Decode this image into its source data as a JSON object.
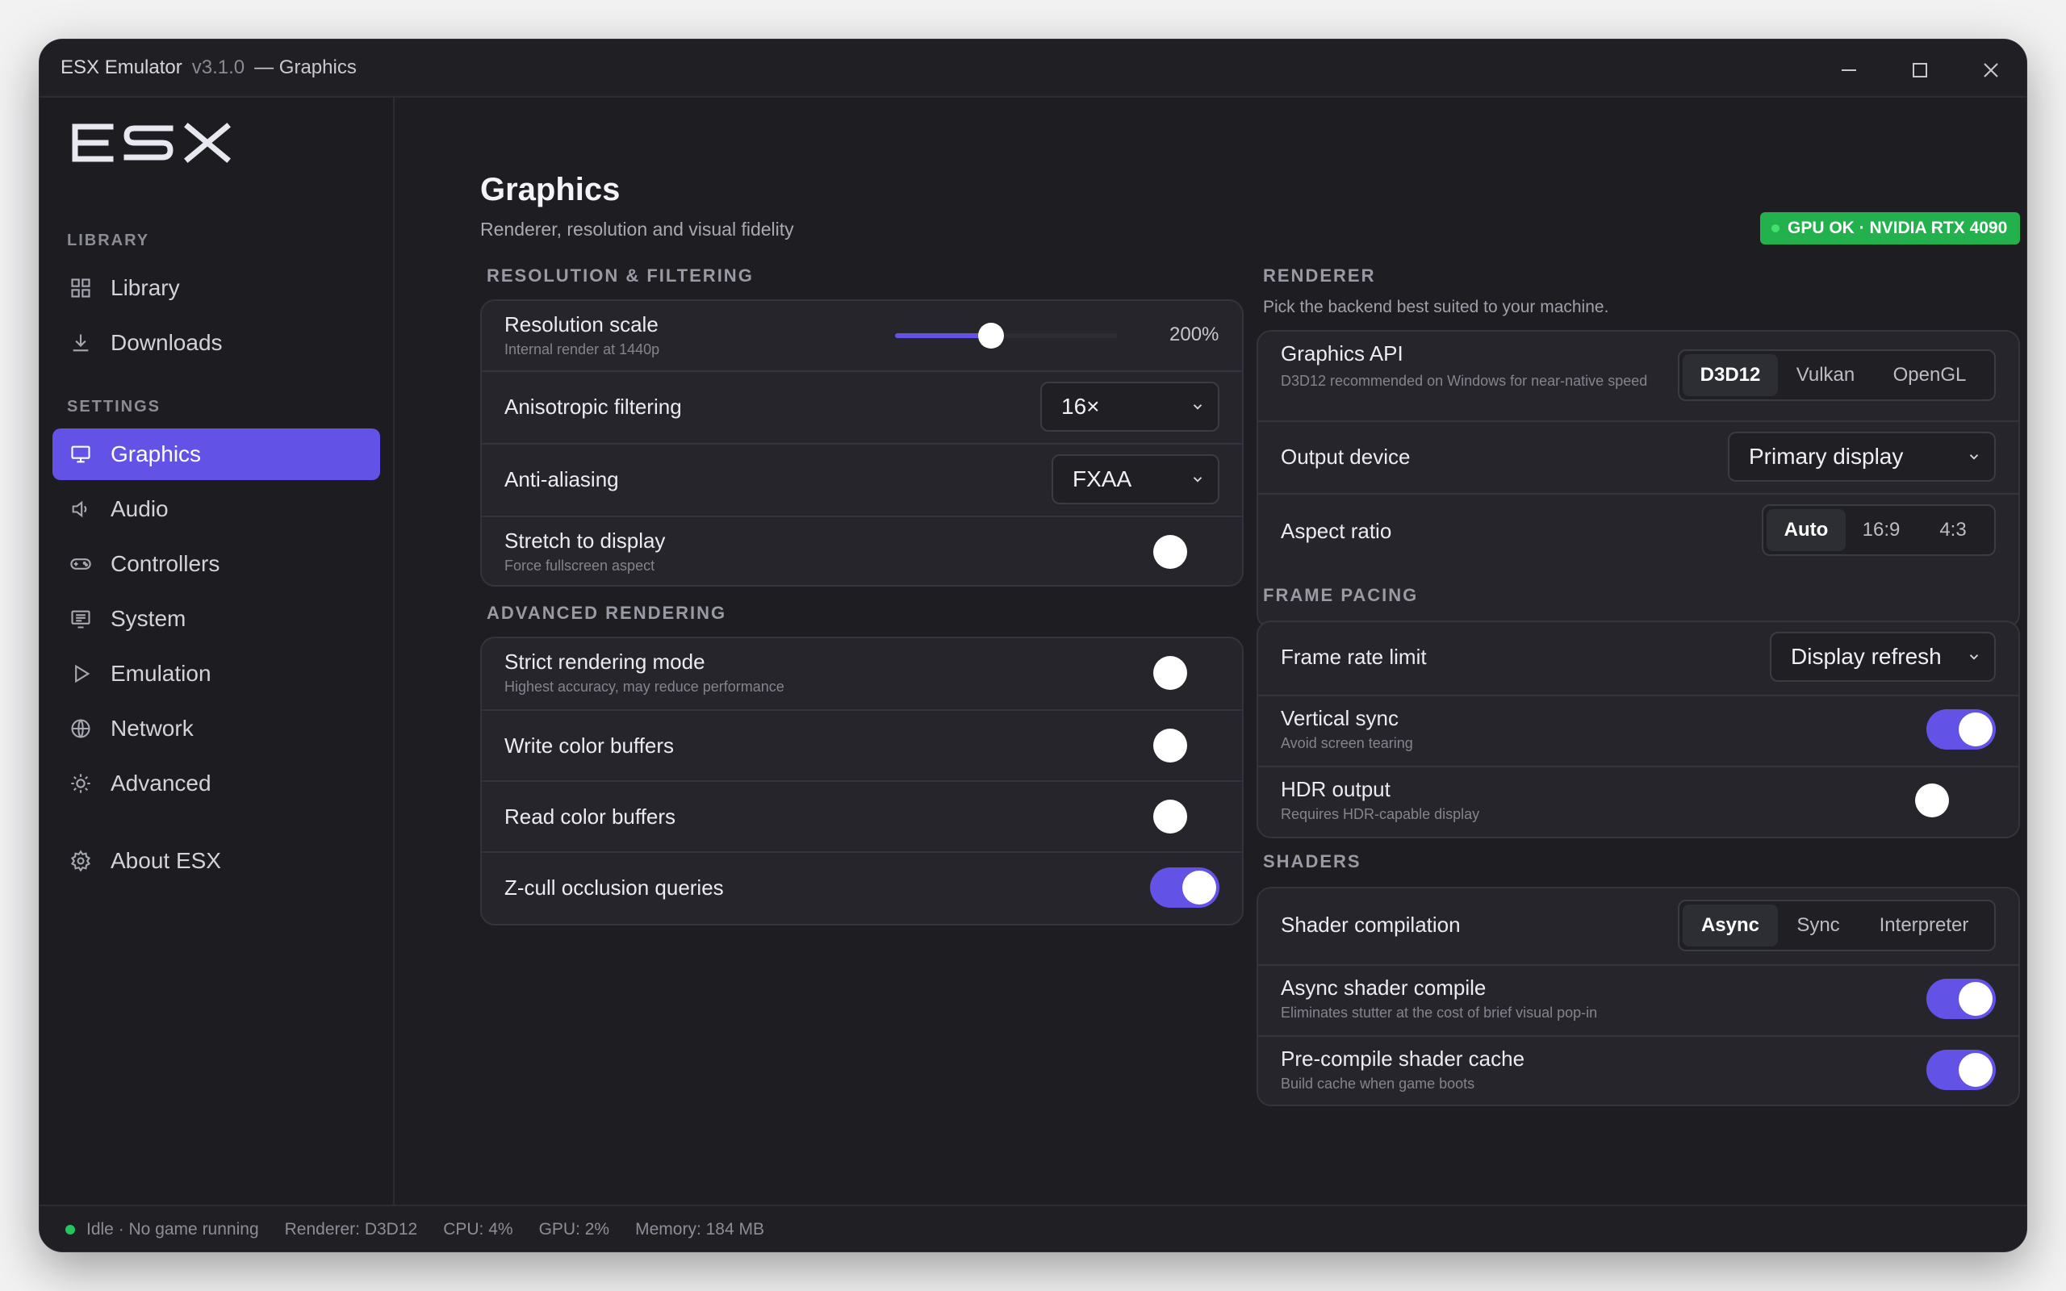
{
  "window": {
    "app_name": "ESX Emulator",
    "version": "v3.1.0",
    "page_suffix": "— Graphics"
  },
  "sidebar": {
    "logo_text": "ESX",
    "library_section": "LIBRARY",
    "settings_section": "SETTINGS",
    "library_items": [
      {
        "label": "Library",
        "icon": "grid-icon"
      },
      {
        "label": "Downloads",
        "icon": "download-icon"
      }
    ],
    "settings_items": [
      {
        "label": "Graphics",
        "icon": "monitor-icon",
        "active": true
      },
      {
        "label": "Audio",
        "icon": "speaker-icon"
      },
      {
        "label": "Controllers",
        "icon": "gamepad-icon"
      },
      {
        "label": "System",
        "icon": "system-icon"
      },
      {
        "label": "Emulation",
        "icon": "play-icon"
      },
      {
        "label": "Network",
        "icon": "globe-icon"
      },
      {
        "label": "Advanced",
        "icon": "sun-icon"
      }
    ],
    "about": {
      "label": "About ESX",
      "icon": "gear-icon"
    }
  },
  "header": {
    "title": "Graphics",
    "subtitle": "Renderer, resolution and visual fidelity",
    "gpu_badge": "GPU OK · NVIDIA RTX 4090"
  },
  "resolution": {
    "section": "RESOLUTION & FILTERING",
    "scale_label": "Resolution scale",
    "scale_hint": "Internal render at 1440p",
    "scale_value": "200%",
    "scale_fraction": 0.43,
    "aniso_label": "Anisotropic filtering",
    "aniso_value": "16×",
    "aa_label": "Anti-aliasing",
    "aa_value": "FXAA",
    "stretch_label": "Stretch to display",
    "stretch_hint": "Force fullscreen aspect",
    "stretch_on": false
  },
  "advanced": {
    "section": "ADVANCED RENDERING",
    "strict_label": "Strict rendering mode",
    "strict_hint": "Highest accuracy, may reduce performance",
    "strict_on": false,
    "write_label": "Write color buffers",
    "write_on": false,
    "read_label": "Read color buffers",
    "read_on": false,
    "zcull_label": "Z-cull occlusion queries",
    "zcull_on": true
  },
  "renderer": {
    "section": "RENDERER",
    "desc": "Pick the backend best suited to your machine.",
    "api_label": "Graphics API",
    "api_hint": "D3D12 recommended on Windows for near-native speed",
    "api_options": [
      "D3D12",
      "Vulkan",
      "OpenGL"
    ],
    "api_selected": "D3D12",
    "output_label": "Output device",
    "output_value": "Primary display",
    "aspect_label": "Aspect ratio",
    "aspect_options": [
      "Auto",
      "16:9",
      "4:3"
    ],
    "aspect_selected": "Auto"
  },
  "frame_pacing": {
    "section": "FRAME PACING",
    "limit_label": "Frame rate limit",
    "limit_value": "Display refresh",
    "vsync_label": "Vertical sync",
    "vsync_hint": "Avoid screen tearing",
    "vsync_on": true,
    "hdr_label": "HDR output",
    "hdr_hint": "Requires HDR-capable display",
    "hdr_on": false
  },
  "shaders": {
    "section": "SHADERS",
    "compile_label": "Shader compilation",
    "compile_options": [
      "Async",
      "Sync",
      "Interpreter"
    ],
    "compile_selected": "Async",
    "async_label": "Async shader compile",
    "async_hint": "Eliminates stutter at the cost of brief visual pop-in",
    "async_on": true,
    "precompile_label": "Pre-compile shader cache",
    "precompile_hint": "Build cache when game boots",
    "precompile_on": true
  },
  "status": {
    "state": "Idle · No game running",
    "renderer": "Renderer: D3D12",
    "cpu": "CPU: 4%",
    "gpu": "GPU: 2%",
    "memory": "Memory: 184 MB"
  },
  "colors": {
    "accent": "#6352e6",
    "ok_green": "#22b14c",
    "background": "#1d1d22"
  }
}
